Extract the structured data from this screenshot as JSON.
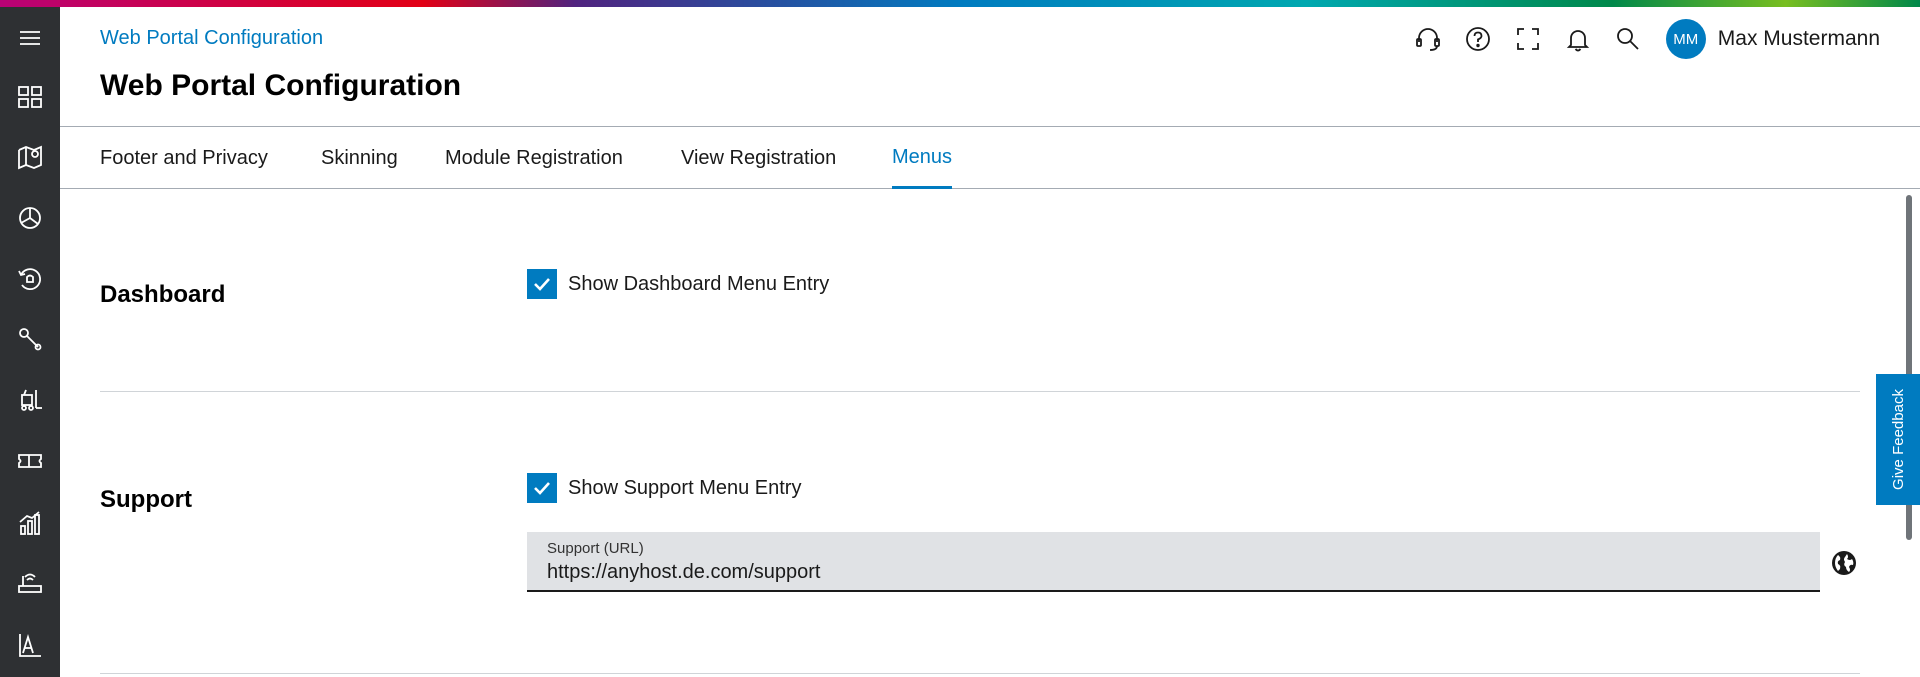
{
  "header": {
    "breadcrumb": "Web Portal Configuration",
    "title": "Web Portal Configuration",
    "user": {
      "initials": "MM",
      "name": "Max Mustermann"
    },
    "toolbar_icons": [
      "headset-icon",
      "help-icon",
      "fullscreen-icon",
      "bell-icon",
      "search-icon"
    ]
  },
  "sidebar": {
    "icons": [
      "menu-icon",
      "dashboard-icon",
      "map-icon",
      "pie-chart-icon",
      "alarm-history-icon",
      "wrench-icon",
      "forklift-icon",
      "ticket-icon",
      "bar-chart-icon",
      "router-icon",
      "analytics-icon"
    ]
  },
  "tabs": [
    {
      "label": "Footer and Privacy",
      "active": false
    },
    {
      "label": "Skinning",
      "active": false
    },
    {
      "label": "Module Registration",
      "active": false
    },
    {
      "label": "View Registration",
      "active": false
    },
    {
      "label": "Menus",
      "active": true
    }
  ],
  "sections": {
    "dashboard": {
      "title": "Dashboard",
      "checkbox_label": "Show Dashboard Menu Entry",
      "checked": true
    },
    "support": {
      "title": "Support",
      "checkbox_label": "Show Support Menu Entry",
      "checked": true,
      "url_field": {
        "label": "Support (URL)",
        "value": "https://anyhost.de.com/support"
      }
    }
  },
  "feedback": {
    "label": "Give Feedback"
  },
  "colors": {
    "accent": "#007bc0",
    "sidebar": "#2e3033",
    "field_bg": "#e0e2e5"
  }
}
